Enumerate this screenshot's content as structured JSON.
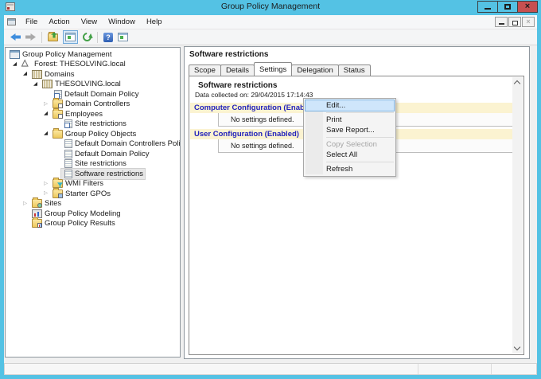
{
  "window": {
    "title": "Group Policy Management"
  },
  "menu_bar": {
    "items": [
      "File",
      "Action",
      "View",
      "Window",
      "Help"
    ]
  },
  "toolbar": {
    "icons": [
      "back",
      "forward",
      "export-list",
      "console-tree-toggle",
      "refresh",
      "help",
      "new-window"
    ]
  },
  "icons": {
    "expanded_glyph": "◢",
    "collapsed_glyph": "▷",
    "close_glyph": "×",
    "mdi_close_glyph": "×",
    "help_glyph": "?"
  },
  "tree": {
    "items": [
      {
        "label": "Group Policy Management",
        "level": 0,
        "expander": "none",
        "icon": "console",
        "selected": false
      },
      {
        "label": "Forest: THESOLVING.local",
        "level": 1,
        "expander": "expanded",
        "icon": "forest",
        "selected": false
      },
      {
        "label": "Domains",
        "level": 2,
        "expander": "expanded",
        "icon": "building",
        "selected": false
      },
      {
        "label": "THESOLVING.local",
        "level": 3,
        "expander": "expanded",
        "icon": "building",
        "selected": false
      },
      {
        "label": "Default Domain Policy",
        "level": 4,
        "expander": "none",
        "icon": "gpo-link",
        "selected": false
      },
      {
        "label": "Domain Controllers",
        "level": 4,
        "expander": "collapsed",
        "icon": "ou",
        "selected": false
      },
      {
        "label": "Employees",
        "level": 4,
        "expander": "expanded",
        "icon": "ou",
        "selected": false
      },
      {
        "label": "Site restrictions",
        "level": 5,
        "expander": "none",
        "icon": "gpo-link",
        "selected": false
      },
      {
        "label": "Group Policy Objects",
        "level": 4,
        "expander": "expanded",
        "icon": "folder-gpo",
        "selected": false
      },
      {
        "label": "Default Domain Controllers Policy",
        "level": 5,
        "expander": "none",
        "icon": "gpo",
        "selected": false
      },
      {
        "label": "Default Domain Policy",
        "level": 5,
        "expander": "none",
        "icon": "gpo",
        "selected": false
      },
      {
        "label": "Site restrictions",
        "level": 5,
        "expander": "none",
        "icon": "gpo",
        "selected": false
      },
      {
        "label": "Software restrictions",
        "level": 5,
        "expander": "none",
        "icon": "gpo",
        "selected": true
      },
      {
        "label": "WMI Filters",
        "level": 4,
        "expander": "collapsed",
        "icon": "folder-wmi",
        "selected": false
      },
      {
        "label": "Starter GPOs",
        "level": 4,
        "expander": "collapsed",
        "icon": "folder-starter",
        "selected": false
      },
      {
        "label": "Sites",
        "level": 2,
        "expander": "collapsed",
        "icon": "folder-sites",
        "selected": false
      },
      {
        "label": "Group Policy Modeling",
        "level": 2,
        "expander": "none",
        "icon": "modeling",
        "selected": false
      },
      {
        "label": "Group Policy Results",
        "level": 2,
        "expander": "none",
        "icon": "folder-results",
        "selected": false
      }
    ]
  },
  "content": {
    "pane_title": "Software restrictions",
    "tabs": [
      {
        "label": "Scope",
        "active": false
      },
      {
        "label": "Details",
        "active": false
      },
      {
        "label": "Settings",
        "active": true
      },
      {
        "label": "Delegation",
        "active": false
      },
      {
        "label": "Status",
        "active": false
      }
    ],
    "report": {
      "title": "Software restrictions",
      "collected": "Data collected on: 29/04/2015 17:14:43",
      "sections": [
        {
          "heading": "Computer Configuration (Enabled)",
          "body": "No settings defined."
        },
        {
          "heading": "User Configuration (Enabled)",
          "body": "No settings defined."
        }
      ]
    }
  },
  "context_menu": {
    "items": [
      {
        "label": "Edit...",
        "state": "highlighted"
      },
      {
        "label": "Print",
        "state": "normal"
      },
      {
        "label": "Save Report...",
        "state": "normal"
      },
      {
        "label": "Copy Selection",
        "state": "disabled"
      },
      {
        "label": "Select All",
        "state": "normal"
      },
      {
        "label": "Refresh",
        "state": "normal"
      }
    ]
  },
  "colors": {
    "titlebar": "#54c2e4",
    "close_button": "#c75050",
    "band_background": "#fbf3d1",
    "band_text": "#2222bb",
    "menu_highlight": "#cfe6fb",
    "menu_highlight_border": "#7db2e0"
  }
}
